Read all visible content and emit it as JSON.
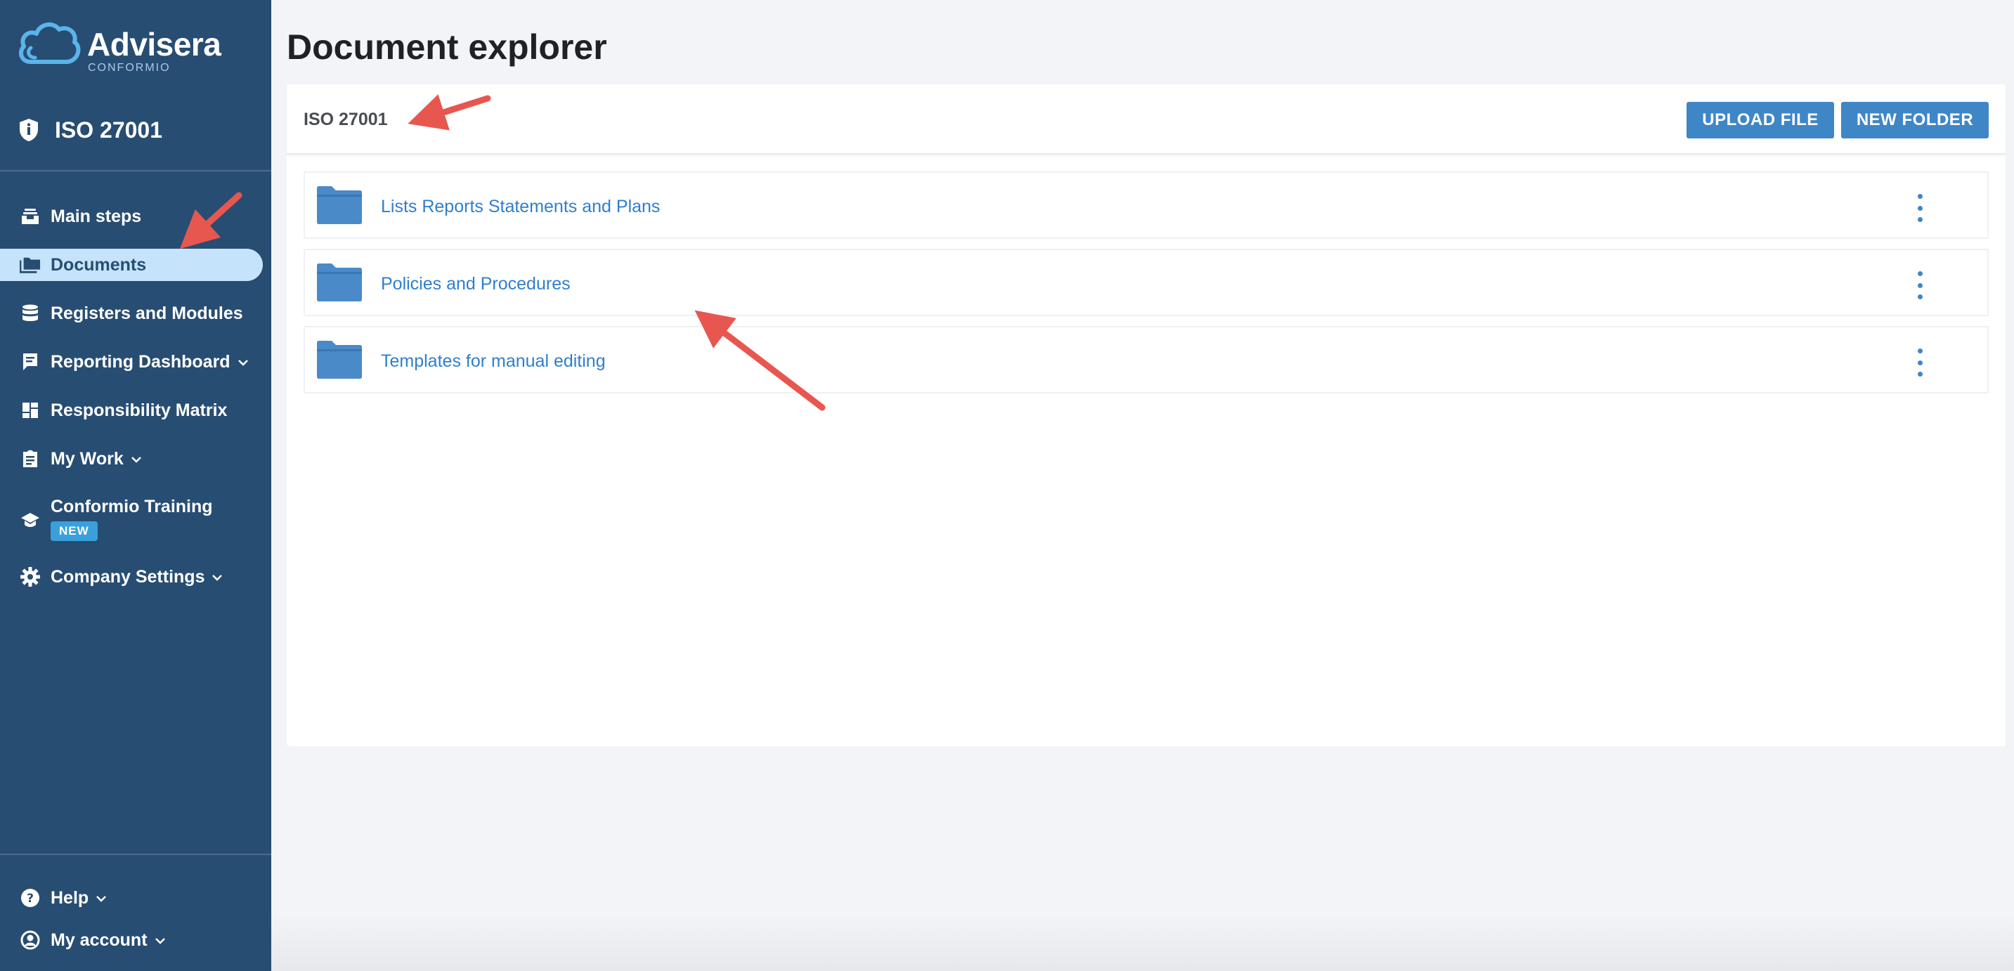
{
  "brand": {
    "name": "Advisera",
    "subtitle": "CONFORMIO"
  },
  "standard": {
    "name": "ISO 27001"
  },
  "sidebar": {
    "items": [
      {
        "label": "Main steps",
        "icon": "inbox-stack-icon",
        "has_chevron": false,
        "active": false
      },
      {
        "label": "Documents",
        "icon": "folders-icon",
        "has_chevron": false,
        "active": true
      },
      {
        "label": "Registers and Modules",
        "icon": "database-icon",
        "has_chevron": false,
        "active": false
      },
      {
        "label": "Reporting Dashboard",
        "icon": "report-icon",
        "has_chevron": true,
        "active": false
      },
      {
        "label": "Responsibility Matrix",
        "icon": "dashboard-grid-icon",
        "has_chevron": false,
        "active": false
      },
      {
        "label": "My Work",
        "icon": "clipboard-icon",
        "has_chevron": true,
        "active": false
      },
      {
        "label": "Conformio Training",
        "icon": "graduation-cap-icon",
        "has_chevron": false,
        "active": false,
        "badge": "NEW"
      },
      {
        "label": "Company Settings",
        "icon": "gear-icon",
        "has_chevron": true,
        "active": false
      }
    ],
    "footer": [
      {
        "label": "Help",
        "icon": "help-circle-icon",
        "has_chevron": true
      },
      {
        "label": "My account",
        "icon": "account-circle-icon",
        "has_chevron": true
      }
    ]
  },
  "main": {
    "title": "Document explorer",
    "breadcrumb": "ISO 27001",
    "buttons": {
      "upload": "UPLOAD FILE",
      "new_folder": "NEW FOLDER"
    },
    "folders": [
      {
        "name": "Lists Reports Statements and Plans"
      },
      {
        "name": "Policies and Procedures"
      },
      {
        "name": "Templates for manual editing"
      }
    ]
  },
  "colors": {
    "sidebar_bg": "#284d72",
    "active_item_bg": "#c5e4fb",
    "accent": "#3f86c7",
    "link": "#2f7fce",
    "badge": "#3aa0db",
    "annotation_arrow": "#e8574f"
  }
}
